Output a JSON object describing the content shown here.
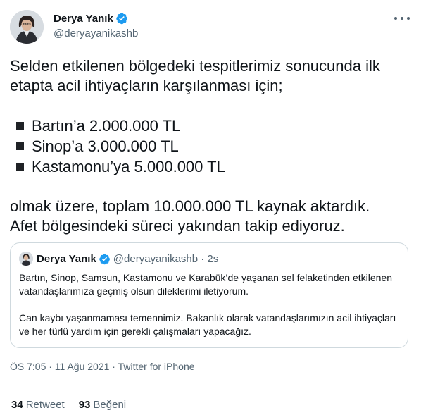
{
  "author": {
    "display_name": "Derya Yanık",
    "handle": "@deryayanikashb",
    "avatar_icon": "profile-photo",
    "verified_icon": "verified-badge-icon"
  },
  "tweet": {
    "paragraph_1": "Selden etkilenen bölgedeki tespitlerimiz sonucunda ilk etapta acil ihtiyaçların karşılanması için;",
    "bullets": [
      "Bartın’a 2.000.000 TL",
      "Sinop’a 3.000.000 TL",
      "Kastamonu’ya 5.000.000 TL"
    ],
    "paragraph_2_line_1": "olmak üzere, toplam 10.000.000 TL kaynak aktardık.",
    "paragraph_2_line_2": "Afet bölgesindeki süreci yakından takip ediyoruz."
  },
  "quoted_tweet": {
    "display_name": "Derya Yanık",
    "meta": "@deryayanikashb · 2s",
    "paragraph_1": "Bartın, Sinop, Samsun, Kastamonu ve Karabük’de yaşanan sel felaketinden etkilenen vatandaşlarımıza geçmiş olsun dileklerimi iletiyorum.",
    "paragraph_2": "Can kaybı yaşanmaması temennimiz. Bakanlık olarak vatandaşlarımızın acil ihtiyaçları ve her türlü yardım için gerekli çalışmaları yapacağız."
  },
  "meta_line": "ÖS 7:05 · 11 Ağu 2021 · Twitter for iPhone",
  "stats": {
    "retweets_count": "34",
    "retweets_label": "Retweet",
    "likes_count": "93",
    "likes_label": "Beğeni"
  },
  "colors": {
    "verified": "#1d9bf0",
    "secondary_text": "#536471",
    "border": "#cfd9de"
  }
}
